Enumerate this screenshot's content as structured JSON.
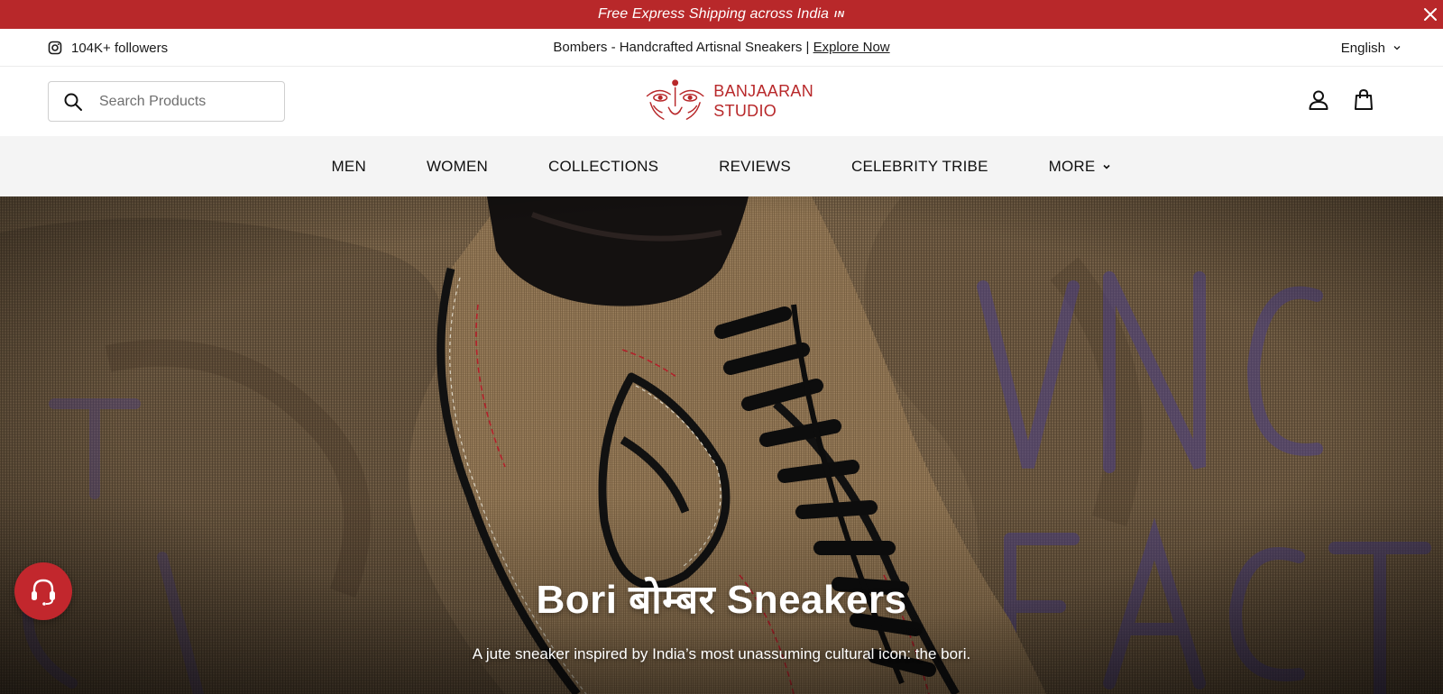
{
  "announcement": {
    "text": "Free Express Shipping across India",
    "flag": "IN",
    "close_icon": "close-icon"
  },
  "utility": {
    "followers_icon": "instagram-icon",
    "followers": "104K+ followers",
    "promo_text": "Bombers - Handcrafted Artisnal Sneakers | ",
    "promo_link": "Explore Now",
    "language": "English"
  },
  "header": {
    "search_placeholder": "Search Products",
    "logo_line1": "BANJAARAN",
    "logo_line2": "STUDIO",
    "account_icon": "user-icon",
    "cart_icon": "shopping-bag-icon"
  },
  "nav": {
    "items": [
      "MEN",
      "WOMEN",
      "COLLECTIONS",
      "REVIEWS",
      "CELEBRITY TRIBE",
      "MORE"
    ]
  },
  "hero": {
    "title": "Bori बोम्बर Sneakers",
    "subtitle": "A jute sneaker inspired by India’s most unassuming cultural icon: the bori."
  },
  "support": {
    "icon": "headset-icon"
  },
  "colors": {
    "brand": "#b8282a",
    "nav_bg": "#f4f4f4",
    "support_bg": "#c2272d"
  }
}
